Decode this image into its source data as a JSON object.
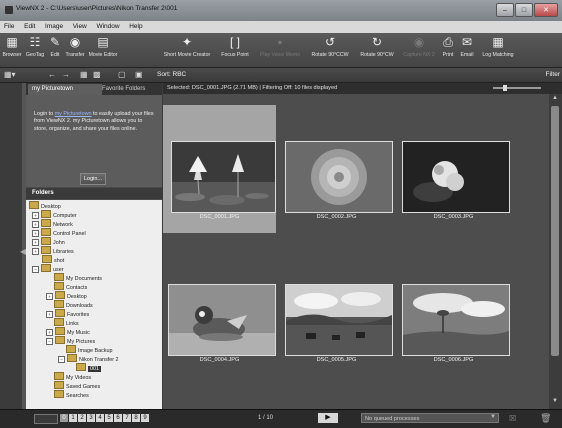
{
  "window": {
    "title": "ViewNX 2 - C:\\Users\\user\\Pictures\\Nikon Transfer 2\\001"
  },
  "menu": [
    "File",
    "Edit",
    "Image",
    "View",
    "Window",
    "Help"
  ],
  "toolbar": {
    "browser": "Browser",
    "geotag": "GeoTag",
    "edit": "Edit",
    "transfer": "Transfer",
    "movie_editor": "Movie Editor",
    "short_movie": "Short Movie Creator",
    "focus_point": "Focus Point",
    "play_voice": "Play Voice Memo",
    "rotate_ccw": "Rotate 90°CCW",
    "rotate_cw": "Rotate 90°CW",
    "capture": "Capture NX 2",
    "print": "Print",
    "email": "Email",
    "log_matching": "Log Matching"
  },
  "toolbar2": {
    "sort": "Sort: RBC",
    "filter": "Filter"
  },
  "left_panel": {
    "tab_active": "my Picturetown",
    "tab_inactive": "Favorite Folders",
    "info_prefix": "Login to",
    "info_link": "my Picturetown",
    "info_rest": "to easily upload your files from ViewNX 2. my Picturetown allows you to store, organize, and share your files online.",
    "login_button": "Login...",
    "folders_header": "Folders",
    "tree": [
      {
        "label": "Desktop"
      },
      {
        "label": "Computer"
      },
      {
        "label": "Network"
      },
      {
        "label": "Control Panel"
      },
      {
        "label": "John"
      },
      {
        "label": "Libraries"
      },
      {
        "label": "shot"
      },
      {
        "label": "user"
      },
      {
        "label": "My Documents"
      },
      {
        "label": "Contacts"
      },
      {
        "label": "Desktop"
      },
      {
        "label": "Downloads"
      },
      {
        "label": "Favorites"
      },
      {
        "label": "Links"
      },
      {
        "label": "My Music"
      },
      {
        "label": "My Pictures"
      },
      {
        "label": "Image Backup"
      },
      {
        "label": "Nikon Transfer 2"
      },
      {
        "label": "001"
      },
      {
        "label": "My Videos"
      },
      {
        "label": "Saved Games"
      },
      {
        "label": "Searches"
      }
    ]
  },
  "status": "Selected: DSC_0001.JPG (2.71 MB) | Filtering Off: 10 files displayed",
  "thumbnails": [
    {
      "name": "DSC_0001.JPG",
      "selected": true
    },
    {
      "name": "DSC_0002.JPG",
      "selected": false
    },
    {
      "name": "DSC_0003.JPG",
      "selected": false
    },
    {
      "name": "DSC_0004.JPG",
      "selected": false
    },
    {
      "name": "DSC_0005.JPG",
      "selected": false
    },
    {
      "name": "DSC_0006.JPG",
      "selected": false
    }
  ],
  "bottom": {
    "ratings": [
      "0",
      "1",
      "2",
      "3",
      "4",
      "5",
      "6",
      "7",
      "8",
      "9"
    ],
    "pager": "1 / 10",
    "queue": "No queued processes"
  }
}
